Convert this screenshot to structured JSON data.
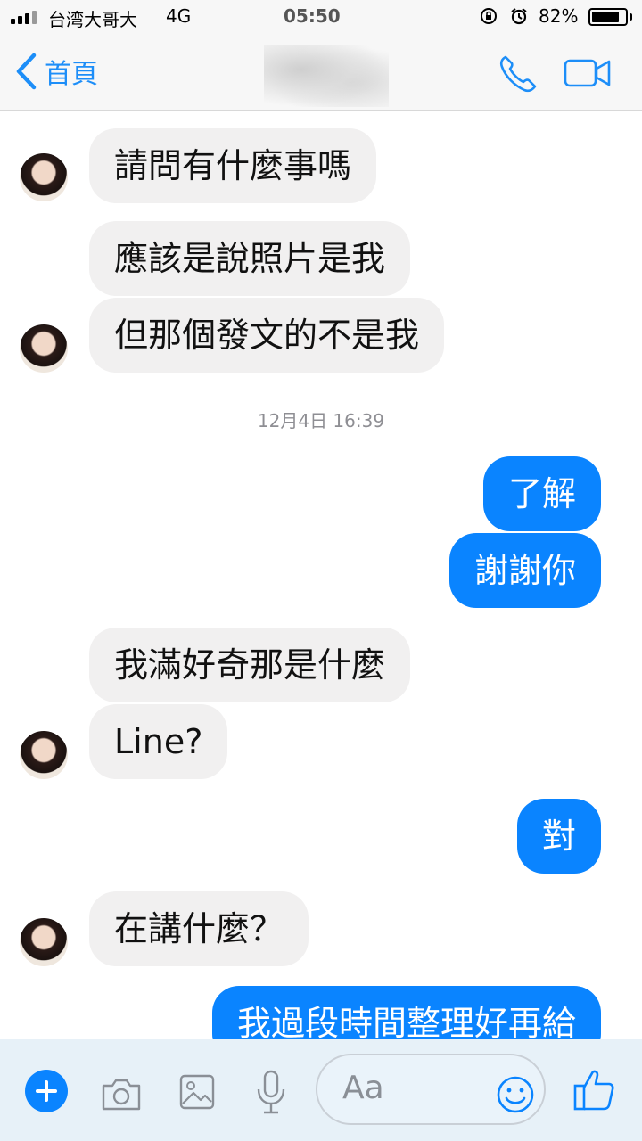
{
  "status_bar": {
    "carrier": "台湾大哥大",
    "network": "4G",
    "time": "05:50",
    "battery_percent": "82%",
    "battery_level": 0.82
  },
  "nav": {
    "back_label": "首頁",
    "accent_color": "#1d8ef8"
  },
  "thread": {
    "timestamp": "12月4日 16:39",
    "messages": [
      {
        "from": "them",
        "text": "請問有什麼事嗎"
      },
      {
        "from": "them",
        "text": "應該是說照片是我"
      },
      {
        "from": "them",
        "text": "但那個發文的不是我"
      },
      {
        "from": "me",
        "text": "了解"
      },
      {
        "from": "me",
        "text": "謝謝你"
      },
      {
        "from": "them",
        "text": "我滿好奇那是什麼"
      },
      {
        "from": "them",
        "text": "Line?"
      },
      {
        "from": "me",
        "text": "對"
      },
      {
        "from": "them",
        "text": "在講什麼？"
      },
      {
        "from": "me",
        "text": "我過段時間整理好再給"
      }
    ]
  },
  "composer": {
    "placeholder": "Aa",
    "icons": [
      "plus-icon",
      "camera-icon",
      "photo-icon",
      "microphone-icon",
      "emoji-icon",
      "thumbs-up-icon"
    ]
  }
}
